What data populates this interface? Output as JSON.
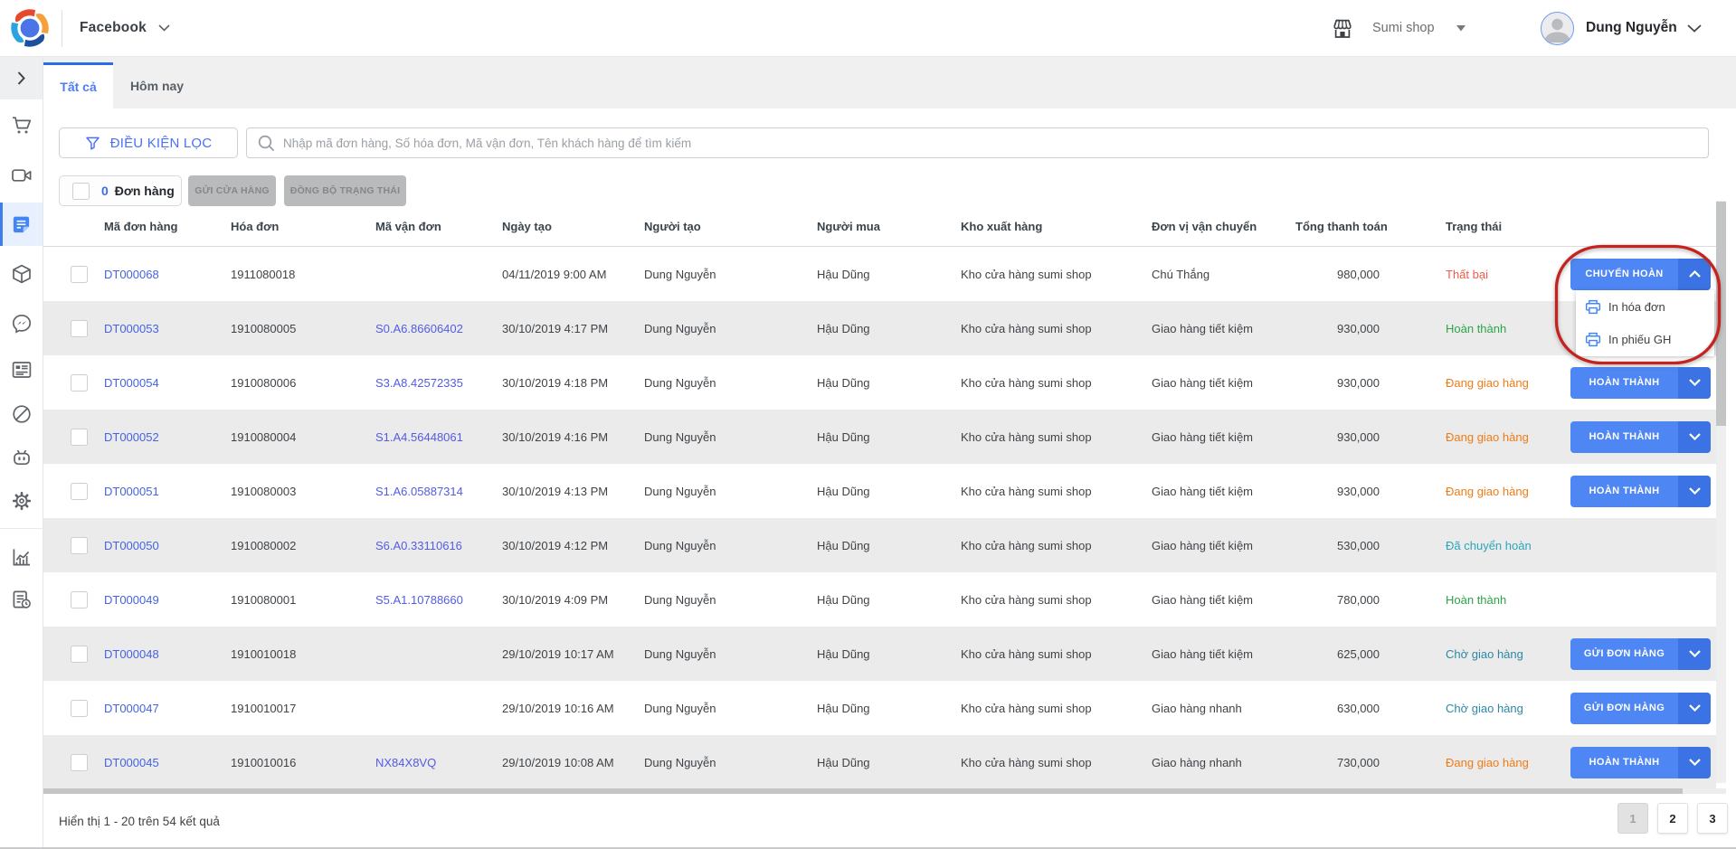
{
  "topbar": {
    "app_title": "Facebook",
    "shop_name": "Sumi shop",
    "user_name": "Dung Nguyễn"
  },
  "tabs": {
    "all": "Tất cả",
    "today": "Hôm nay"
  },
  "toolbar": {
    "filter_label": "ĐIỀU KIỆN LỌC",
    "search_placeholder": "Nhập mã đơn hàng, Số hóa đơn, Mã vận đơn, Tên khách hàng để tìm kiếm",
    "selected_count": "0",
    "selected_label": "Đơn hàng",
    "send_store_label": "GỬI CỬA HÀNG",
    "sync_status_label": "ĐỒNG BỘ TRẠNG THÁI"
  },
  "table": {
    "headers": [
      "Mã đơn hàng",
      "Hóa đơn",
      "Mã vận đơn",
      "Ngày tạo",
      "Người tạo",
      "Người mua",
      "Kho xuất hàng",
      "Đơn vị vận chuyển",
      "Tổng thanh toán",
      "Trạng thái"
    ],
    "rows": [
      {
        "id": "DT000068",
        "invoice": "1911080018",
        "tracking": "",
        "created": "04/11/2019 9:00 AM",
        "creator": "Dung Nguyễn",
        "buyer": "Hậu Dũng",
        "warehouse": "Kho cửa hàng sumi shop",
        "carrier": "Chú Thắng",
        "total": "980,000",
        "status": {
          "label": "Thất bại",
          "color": "#f25a4c"
        },
        "action": {
          "label": "CHUYẾN HOÀN",
          "caret": "up"
        }
      },
      {
        "id": "DT000053",
        "invoice": "1910080005",
        "tracking": "S0.A6.86606402",
        "created": "30/10/2019 4:17 PM",
        "creator": "Dung Nguyễn",
        "buyer": "Hậu Dũng",
        "warehouse": "Kho cửa hàng sumi shop",
        "carrier": "Giao hàng tiết kiệm",
        "total": "930,000",
        "status": {
          "label": "Hoàn thành",
          "color": "#2da44a"
        },
        "action": null
      },
      {
        "id": "DT000054",
        "invoice": "1910080006",
        "tracking": "S3.A8.42572335",
        "created": "30/10/2019 4:18 PM",
        "creator": "Dung Nguyễn",
        "buyer": "Hậu Dũng",
        "warehouse": "Kho cửa hàng sumi shop",
        "carrier": "Giao hàng tiết kiệm",
        "total": "930,000",
        "status": {
          "label": "Đang giao hàng",
          "color": "#f07b16"
        },
        "action": {
          "label": "HOÀN THÀNH",
          "caret": "down"
        }
      },
      {
        "id": "DT000052",
        "invoice": "1910080004",
        "tracking": "S1.A4.56448061",
        "created": "30/10/2019 4:16 PM",
        "creator": "Dung Nguyễn",
        "buyer": "Hậu Dũng",
        "warehouse": "Kho cửa hàng sumi shop",
        "carrier": "Giao hàng tiết kiệm",
        "total": "930,000",
        "status": {
          "label": "Đang giao hàng",
          "color": "#f07b16"
        },
        "action": {
          "label": "HOÀN THÀNH",
          "caret": "down"
        }
      },
      {
        "id": "DT000051",
        "invoice": "1910080003",
        "tracking": "S1.A6.05887314",
        "created": "30/10/2019 4:13 PM",
        "creator": "Dung Nguyễn",
        "buyer": "Hậu Dũng",
        "warehouse": "Kho cửa hàng sumi shop",
        "carrier": "Giao hàng tiết kiệm",
        "total": "930,000",
        "status": {
          "label": "Đang giao hàng",
          "color": "#f07b16"
        },
        "action": {
          "label": "HOÀN THÀNH",
          "caret": "down"
        }
      },
      {
        "id": "DT000050",
        "invoice": "1910080002",
        "tracking": "S6.A0.33110616",
        "created": "30/10/2019 4:12 PM",
        "creator": "Dung Nguyễn",
        "buyer": "Hậu Dũng",
        "warehouse": "Kho cửa hàng sumi shop",
        "carrier": "Giao hàng tiết kiệm",
        "total": "530,000",
        "status": {
          "label": "Đã chuyển hoàn",
          "color": "#2aa6ba"
        },
        "action": null
      },
      {
        "id": "DT000049",
        "invoice": "1910080001",
        "tracking": "S5.A1.10788660",
        "created": "30/10/2019 4:09 PM",
        "creator": "Dung Nguyễn",
        "buyer": "Hậu Dũng",
        "warehouse": "Kho cửa hàng sumi shop",
        "carrier": "Giao hàng tiết kiệm",
        "total": "780,000",
        "status": {
          "label": "Hoàn thành",
          "color": "#2da44a"
        },
        "action": null
      },
      {
        "id": "DT000048",
        "invoice": "1910010018",
        "tracking": "",
        "created": "29/10/2019 10:17 AM",
        "creator": "Dung Nguyễn",
        "buyer": "Hậu Dũng",
        "warehouse": "Kho cửa hàng sumi shop",
        "carrier": "Giao hàng tiết kiệm",
        "total": "625,000",
        "status": {
          "label": "Chờ giao hàng",
          "color": "#2c88a6"
        },
        "action": {
          "label": "GỬI ĐƠN HÀNG",
          "caret": "down"
        }
      },
      {
        "id": "DT000047",
        "invoice": "1910010017",
        "tracking": "",
        "created": "29/10/2019 10:16 AM",
        "creator": "Dung Nguyễn",
        "buyer": "Hậu Dũng",
        "warehouse": "Kho cửa hàng sumi shop",
        "carrier": "Giao hàng nhanh",
        "total": "630,000",
        "status": {
          "label": "Chờ giao hàng",
          "color": "#2c88a6"
        },
        "action": {
          "label": "GỬI ĐƠN HÀNG",
          "caret": "down"
        }
      },
      {
        "id": "DT000045",
        "invoice": "1910010016",
        "tracking": "NX84X8VQ",
        "created": "29/10/2019 10:08 AM",
        "creator": "Dung Nguyễn",
        "buyer": "Hậu Dũng",
        "warehouse": "Kho cửa hàng sumi shop",
        "carrier": "Giao hàng nhanh",
        "total": "730,000",
        "status": {
          "label": "Đang giao hàng",
          "color": "#f07b16"
        },
        "action": {
          "label": "HOÀN THÀNH",
          "caret": "down"
        }
      }
    ]
  },
  "dropdown": {
    "items": [
      {
        "label": "In hóa đơn"
      },
      {
        "label": "In phiếu GH"
      }
    ]
  },
  "footer": {
    "summary": "Hiển thị 1 - 20 trên 54 kết quả",
    "pages": [
      "1",
      "2",
      "3"
    ]
  },
  "colors": {
    "accent_blue": "#4e86f3",
    "accent_blue_dark": "#3b73e4",
    "link_order": "#4563e4",
    "link_tracking": "#535ce0",
    "status_failed": "#f25a4c",
    "status_done": "#2da44a",
    "status_shipping": "#f07b16",
    "status_returned": "#2aa6ba",
    "status_waiting": "#2c88a6",
    "annotation_red": "#c32020"
  }
}
